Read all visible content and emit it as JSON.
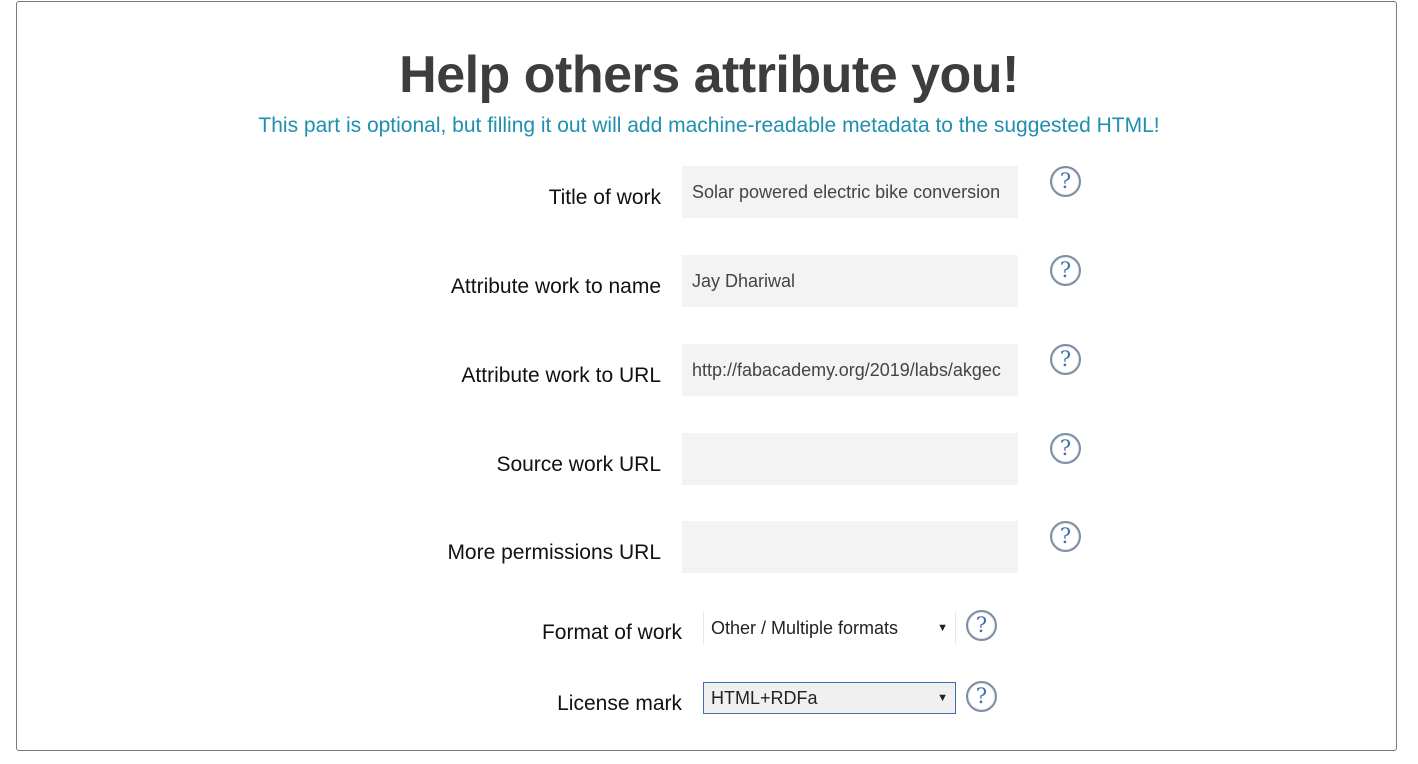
{
  "header": {
    "title": "Help others attribute you!",
    "subtitle": "This part is optional, but filling it out will add machine-readable metadata to the suggested HTML!"
  },
  "fields": {
    "title_of_work": {
      "label": "Title of work",
      "value": "Solar powered electric bike conversion"
    },
    "attribute_name": {
      "label": "Attribute work to name",
      "value": "Jay Dhariwal"
    },
    "attribute_url": {
      "label": "Attribute work to URL",
      "value": "http://fabacademy.org/2019/labs/akgec"
    },
    "source_url": {
      "label": "Source work URL",
      "value": ""
    },
    "permissions_url": {
      "label": "More permissions URL",
      "value": ""
    },
    "format": {
      "label": "Format of work",
      "selected": "Other / Multiple formats"
    },
    "license_mark": {
      "label": "License mark",
      "selected": "HTML+RDFa"
    }
  },
  "icons": {
    "help": "?",
    "dropdown": "▼"
  }
}
